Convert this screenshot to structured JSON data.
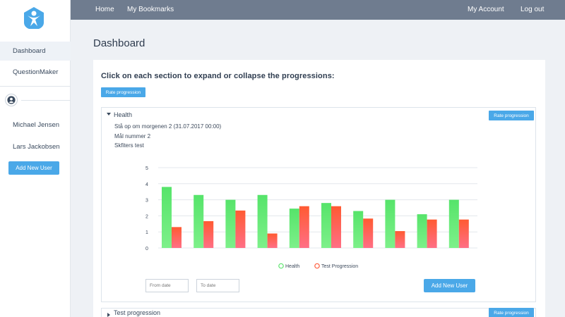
{
  "topbar": {
    "nav": [
      "Home",
      "My Bookmarks"
    ],
    "right": [
      "My Account",
      "Log out"
    ]
  },
  "sidebar": {
    "items": [
      "Dashboard",
      "QuestionMaker"
    ],
    "users": [
      "Michael Jensen",
      "Lars Jackobsen"
    ],
    "add_user_label": "Add New User",
    "logo_icon": "person-star-logo",
    "user_icon": "user-circle-icon"
  },
  "page": {
    "title": "Dashboard",
    "instruction": "Click on each section to expand or collapse the progressions:",
    "rate_label": "Rate progression"
  },
  "panels": [
    {
      "title": "Health",
      "expanded": true,
      "rate_label": "Rate progression",
      "lines": [
        "Stå op om morgenen 2 (31.07.2017 00:00)",
        "Mål nummer 2",
        "Skfiters test"
      ],
      "from_placeholder": "From date",
      "to_placeholder": "To date",
      "add_user_label": "Add New User"
    },
    {
      "title": "Test progression",
      "expanded": false,
      "rate_label": "Rate progression"
    }
  ],
  "colors": {
    "accent": "#4aa8e8",
    "topbar": "#6f7c8f",
    "series_green": "#5ee56f",
    "series_red": "#ff5d3d"
  },
  "chart_data": {
    "type": "bar",
    "categories": [
      "",
      "",
      "",
      "",
      "",
      "",
      "",
      "",
      "",
      ""
    ],
    "series": [
      {
        "name": "Health",
        "values": [
          3.8,
          3.3,
          3.0,
          3.3,
          2.45,
          2.8,
          2.3,
          3.0,
          2.1,
          3.0
        ]
      },
      {
        "name": "Test Progression",
        "values": [
          1.3,
          1.67,
          2.33,
          0.9,
          2.6,
          2.6,
          1.83,
          1.05,
          1.77,
          1.77
        ]
      }
    ],
    "ylim": [
      0,
      5
    ],
    "yticks": [
      "0",
      "1",
      "2",
      "3",
      "4",
      "5"
    ],
    "grid": true,
    "legend": "bottom-center"
  }
}
